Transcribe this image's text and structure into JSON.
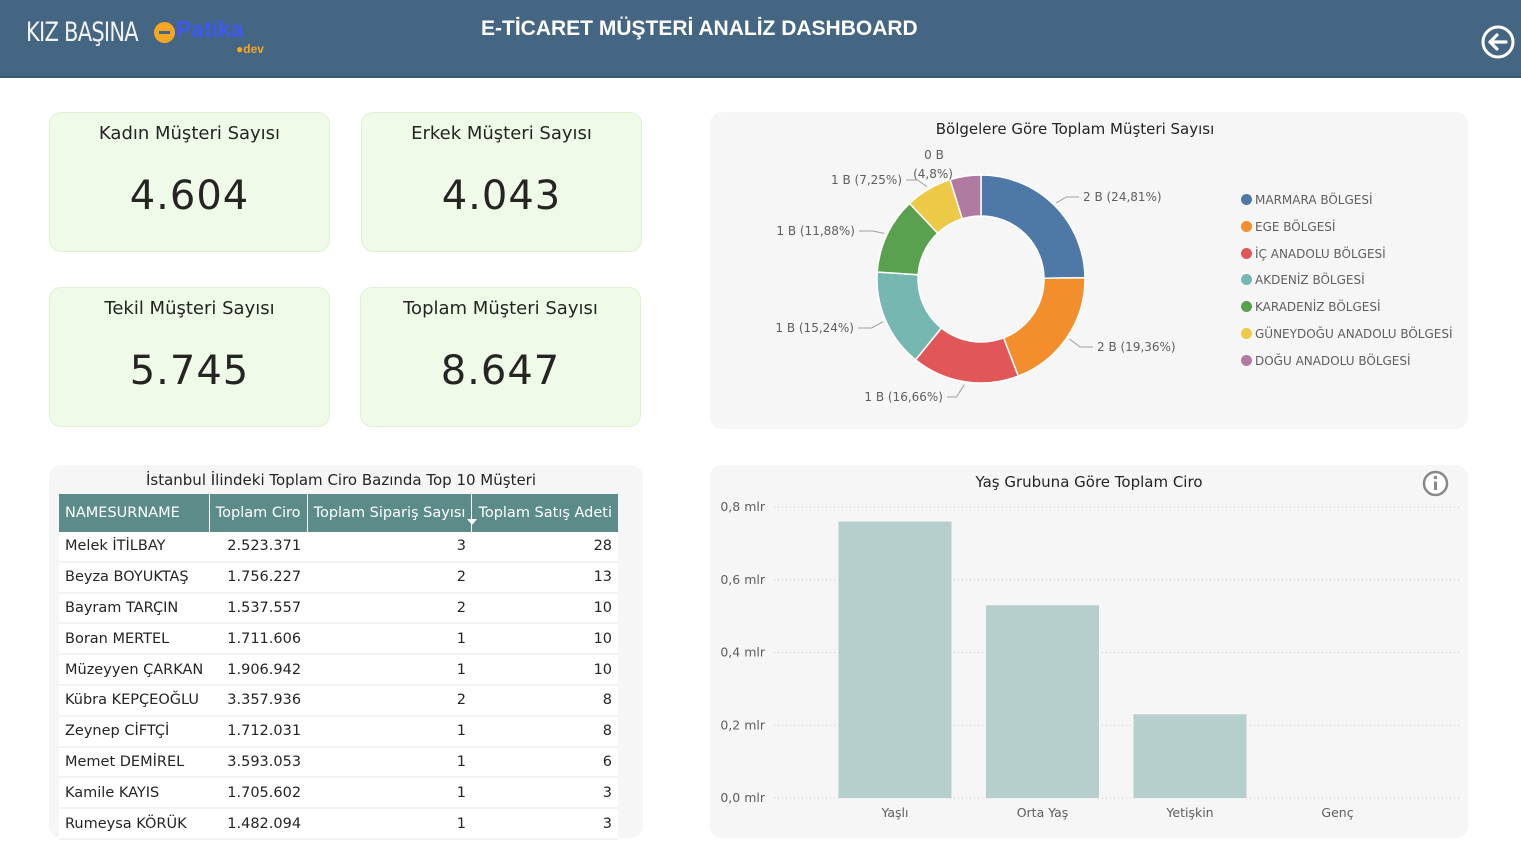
{
  "header": {
    "logo_kiz": "KIZ BAŞINA",
    "logo_patika": "Patika",
    "logo_dev": "dev",
    "title": "E-TİCARET MÜŞTERİ ANALİZ DASHBOARD",
    "back_icon": "back-arrow-circle-icon"
  },
  "kpis": {
    "kadin": {
      "label": "Kadın Müşteri Sayısı",
      "value": "4.604"
    },
    "erkek": {
      "label": "Erkek Müşteri Sayısı",
      "value": "4.043"
    },
    "tekil": {
      "label": "Tekil Müşteri Sayısı",
      "value": "5.745"
    },
    "toplam": {
      "label": "Toplam Müşteri Sayısı",
      "value": "8.647"
    }
  },
  "table": {
    "title": "İstanbul İlindeki Toplam Ciro Bazında Top 10 Müşteri",
    "columns": [
      "NAMESURNAME",
      "Toplam Ciro",
      "Toplam Sipariş Sayısı",
      "Toplam Satış Adeti"
    ],
    "rows": [
      [
        "Melek İTİLBAY",
        "2.523.371",
        "3",
        "28"
      ],
      [
        "Beyza BOYUKTAŞ",
        "1.756.227",
        "2",
        "13"
      ],
      [
        "Bayram TARÇIN",
        "1.537.557",
        "2",
        "10"
      ],
      [
        "Boran MERTEL",
        "1.711.606",
        "1",
        "10"
      ],
      [
        "Müzeyyen ÇARKAN",
        "1.906.942",
        "1",
        "10"
      ],
      [
        "Kübra KEPÇEOĞLU",
        "3.357.936",
        "2",
        "8"
      ],
      [
        "Zeynep CİFTÇİ",
        "1.712.031",
        "1",
        "8"
      ],
      [
        "Memet DEMİREL",
        "3.593.053",
        "1",
        "6"
      ],
      [
        "Kamile KAYIS",
        "1.705.602",
        "1",
        "3"
      ],
      [
        "Rumeysa KÖRÜK",
        "1.482.094",
        "1",
        "3"
      ]
    ]
  },
  "chart_data": [
    {
      "type": "pie",
      "title": "Bölgelere Göre Toplam Müşteri Sayısı",
      "categories": [
        "MARMARA BÖLGESİ",
        "EGE BÖLGESİ",
        "İÇ ANADOLU BÖLGESİ",
        "AKDENİZ BÖLGESİ",
        "KARADENİZ BÖLGESİ",
        "GÜNEYDOĞU ANADOLU BÖLGESİ",
        "DOĞU ANADOLU BÖLGESİ"
      ],
      "values": [
        24.81,
        19.36,
        16.66,
        15.24,
        11.88,
        7.25,
        4.8
      ],
      "data_labels": [
        "2 B (24,81%)",
        "2 B (19,36%)",
        "1 B (16,66%)",
        "1 B (15,24%)",
        "1 B (11,88%)",
        "1 B (7,25%)",
        "0 B (4,8%)"
      ],
      "colors": [
        "#4e79a7",
        "#f28e2b",
        "#e15759",
        "#76b7b2",
        "#59a14f",
        "#edc948",
        "#b07aa1"
      ],
      "donut": true,
      "legend": "right"
    },
    {
      "type": "bar",
      "title": "Yaş Grubuna Göre Toplam Ciro",
      "categories": [
        "Yaşlı",
        "Orta Yaş",
        "Yetişkin",
        "Genç"
      ],
      "values": [
        0.76,
        0.53,
        0.23,
        0
      ],
      "yticks": [
        "0,0 mlr",
        "0,2 mlr",
        "0,4 mlr",
        "0,6 mlr",
        "0,8 mlr"
      ],
      "ylim": [
        0,
        0.8
      ],
      "color": "#b7cfcc",
      "grid": true
    }
  ]
}
